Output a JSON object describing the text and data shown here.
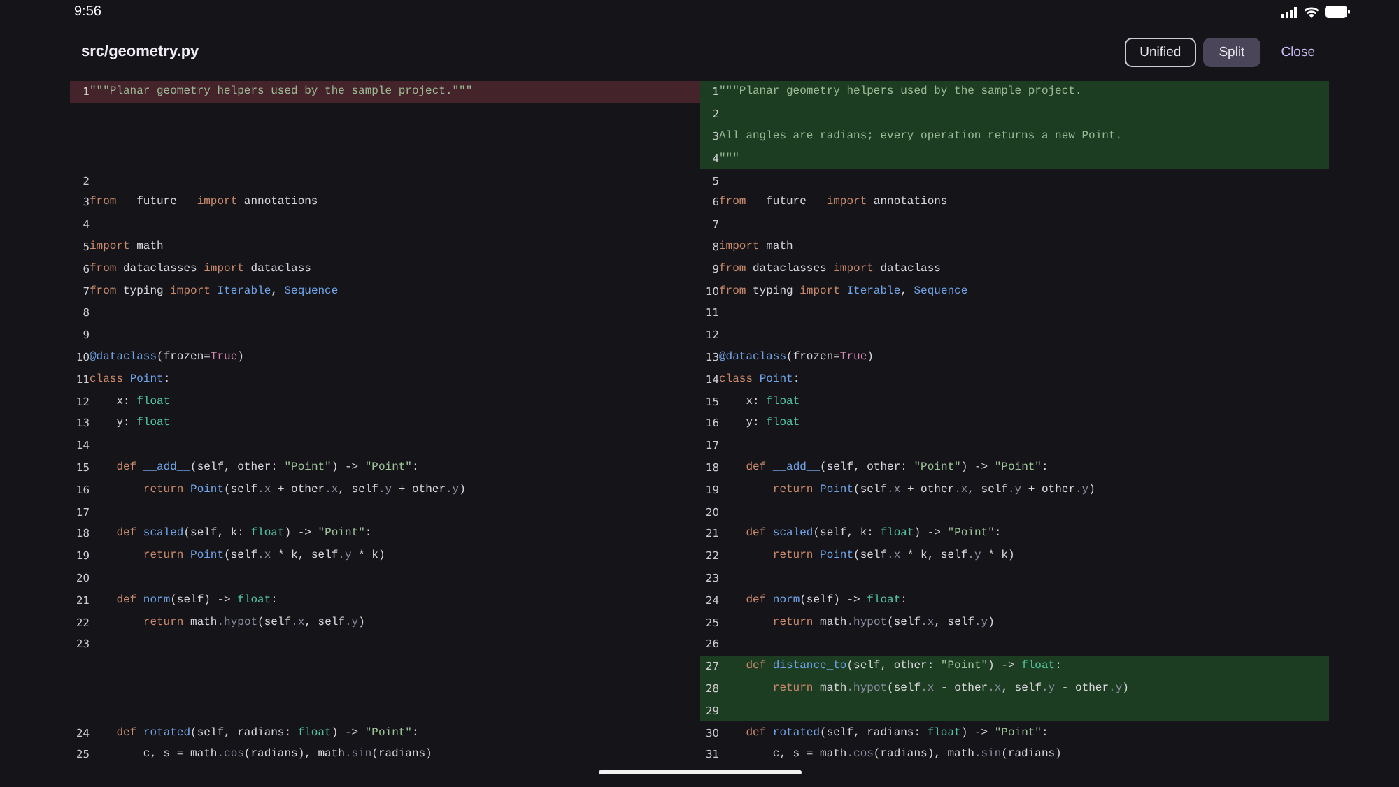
{
  "status_bar": {
    "time": "9:56"
  },
  "header": {
    "title": "src/geometry.py",
    "modes": [
      {
        "label": "Unified",
        "selected": false
      },
      {
        "label": "Split",
        "selected": true
      }
    ],
    "close": "Close"
  },
  "panes": [
    {
      "kind": "old",
      "rows": [
        {
          "num": "1",
          "changed": true,
          "tokens": [
            {
              "kind": "doc",
              "text": "\"\"\"Planar geometry helpers used by the sample project.\"\"\""
            }
          ]
        },
        {
          "changed": false
        },
        {
          "changed": false
        },
        {
          "changed": false
        },
        {
          "num": "2",
          "changed": false
        },
        {
          "num": "3",
          "changed": false,
          "tokens": [
            {
              "kind": "kw",
              "text": "from"
            },
            {
              "kind": "plain",
              "text": " __future__ "
            },
            {
              "kind": "kw",
              "text": "import"
            },
            {
              "kind": "plain",
              "text": " annotations"
            }
          ]
        },
        {
          "num": "4",
          "changed": false
        },
        {
          "num": "5",
          "changed": false,
          "tokens": [
            {
              "kind": "kw",
              "text": "import"
            },
            {
              "kind": "plain",
              "text": " math"
            }
          ]
        },
        {
          "num": "6",
          "changed": false,
          "tokens": [
            {
              "kind": "kw",
              "text": "from"
            },
            {
              "kind": "plain",
              "text": " dataclasses "
            },
            {
              "kind": "kw",
              "text": "import"
            },
            {
              "kind": "plain",
              "text": " dataclass"
            }
          ]
        },
        {
          "num": "7",
          "changed": false,
          "tokens": [
            {
              "kind": "kw",
              "text": "from"
            },
            {
              "kind": "plain",
              "text": " typing "
            },
            {
              "kind": "kw",
              "text": "import"
            },
            {
              "kind": "fn",
              "text": " Iterable"
            },
            {
              "kind": "plain",
              "text": ", "
            },
            {
              "kind": "fn",
              "text": "Sequence"
            }
          ]
        },
        {
          "num": "8",
          "changed": false
        },
        {
          "num": "9",
          "changed": false
        },
        {
          "num": "10",
          "changed": false,
          "tokens": [
            {
              "kind": "fn",
              "text": "@dataclass"
            },
            {
              "kind": "plain",
              "text": "(frozen="
            },
            {
              "kind": "const",
              "text": "True"
            },
            {
              "kind": "plain",
              "text": ")"
            }
          ]
        },
        {
          "num": "11",
          "changed": false,
          "tokens": [
            {
              "kind": "kw",
              "text": "class"
            },
            {
              "kind": "fn",
              "text": " Point"
            },
            {
              "kind": "plain",
              "text": ":"
            }
          ]
        },
        {
          "num": "12",
          "changed": false,
          "tokens": [
            {
              "kind": "plain",
              "text": "    x: "
            },
            {
              "kind": "ty",
              "text": "float"
            }
          ]
        },
        {
          "num": "13",
          "changed": false,
          "tokens": [
            {
              "kind": "plain",
              "text": "    y: "
            },
            {
              "kind": "ty",
              "text": "float"
            }
          ]
        },
        {
          "num": "14",
          "changed": false
        },
        {
          "num": "15",
          "changed": false,
          "tokens": [
            {
              "kind": "kw",
              "text": "    def"
            },
            {
              "kind": "fn",
              "text": " __add__"
            },
            {
              "kind": "plain",
              "text": "(self, other: "
            },
            {
              "kind": "str",
              "text": "\"Point\""
            },
            {
              "kind": "plain",
              "text": ") -> "
            },
            {
              "kind": "str",
              "text": "\"Point\""
            },
            {
              "kind": "plain",
              "text": ":"
            }
          ]
        },
        {
          "num": "16",
          "changed": false,
          "tokens": [
            {
              "kind": "kw",
              "text": "        return"
            },
            {
              "kind": "fn",
              "text": " Point"
            },
            {
              "kind": "plain",
              "text": "(self"
            },
            {
              "kind": "attr",
              "text": ".x"
            },
            {
              "kind": "plain",
              "text": " + other"
            },
            {
              "kind": "attr",
              "text": ".x"
            },
            {
              "kind": "plain",
              "text": ", self"
            },
            {
              "kind": "attr",
              "text": ".y"
            },
            {
              "kind": "plain",
              "text": " + other"
            },
            {
              "kind": "attr",
              "text": ".y"
            },
            {
              "kind": "plain",
              "text": ")"
            }
          ]
        },
        {
          "num": "17",
          "changed": false
        },
        {
          "num": "18",
          "changed": false,
          "tokens": [
            {
              "kind": "kw",
              "text": "    def"
            },
            {
              "kind": "fn",
              "text": " scaled"
            },
            {
              "kind": "plain",
              "text": "(self, k: "
            },
            {
              "kind": "ty",
              "text": "float"
            },
            {
              "kind": "plain",
              "text": ") -> "
            },
            {
              "kind": "str",
              "text": "\"Point\""
            },
            {
              "kind": "plain",
              "text": ":"
            }
          ]
        },
        {
          "num": "19",
          "changed": false,
          "tokens": [
            {
              "kind": "kw",
              "text": "        return"
            },
            {
              "kind": "fn",
              "text": " Point"
            },
            {
              "kind": "plain",
              "text": "(self"
            },
            {
              "kind": "attr",
              "text": ".x"
            },
            {
              "kind": "plain",
              "text": " * k, self"
            },
            {
              "kind": "attr",
              "text": ".y"
            },
            {
              "kind": "plain",
              "text": " * k)"
            }
          ]
        },
        {
          "num": "20",
          "changed": false
        },
        {
          "num": "21",
          "changed": false,
          "tokens": [
            {
              "kind": "kw",
              "text": "    def"
            },
            {
              "kind": "fn",
              "text": " norm"
            },
            {
              "kind": "plain",
              "text": "(self) -> "
            },
            {
              "kind": "ty",
              "text": "float"
            },
            {
              "kind": "plain",
              "text": ":"
            }
          ]
        },
        {
          "num": "22",
          "changed": false,
          "tokens": [
            {
              "kind": "kw",
              "text": "        return"
            },
            {
              "kind": "plain",
              "text": " math"
            },
            {
              "kind": "attr",
              "text": ".hypot"
            },
            {
              "kind": "plain",
              "text": "(self"
            },
            {
              "kind": "attr",
              "text": ".x"
            },
            {
              "kind": "plain",
              "text": ", self"
            },
            {
              "kind": "attr",
              "text": ".y"
            },
            {
              "kind": "plain",
              "text": ")"
            }
          ]
        },
        {
          "num": "23",
          "changed": false
        },
        {
          "changed": false
        },
        {
          "changed": false
        },
        {
          "changed": false
        },
        {
          "num": "24",
          "changed": false,
          "tokens": [
            {
              "kind": "kw",
              "text": "    def"
            },
            {
              "kind": "fn",
              "text": " rotated"
            },
            {
              "kind": "plain",
              "text": "(self, radians: "
            },
            {
              "kind": "ty",
              "text": "float"
            },
            {
              "kind": "plain",
              "text": ") -> "
            },
            {
              "kind": "str",
              "text": "\"Point\""
            },
            {
              "kind": "plain",
              "text": ":"
            }
          ]
        },
        {
          "num": "25",
          "changed": false,
          "tokens": [
            {
              "kind": "plain",
              "text": "        c, s = math"
            },
            {
              "kind": "attr",
              "text": ".cos"
            },
            {
              "kind": "plain",
              "text": "(radians), math"
            },
            {
              "kind": "attr",
              "text": ".sin"
            },
            {
              "kind": "plain",
              "text": "(radians)"
            }
          ]
        }
      ]
    },
    {
      "kind": "new",
      "rows": [
        {
          "num": "1",
          "changed": true,
          "tokens": [
            {
              "kind": "doc",
              "text": "\"\"\"Planar geometry helpers used by the sample project."
            }
          ]
        },
        {
          "num": "2",
          "changed": true
        },
        {
          "num": "3",
          "changed": true,
          "tokens": [
            {
              "kind": "doc",
              "text": "All angles are radians; every operation returns a new Point."
            }
          ]
        },
        {
          "num": "4",
          "changed": true,
          "tokens": [
            {
              "kind": "doc",
              "text": "\"\"\""
            }
          ]
        },
        {
          "num": "5",
          "changed": false
        },
        {
          "num": "6",
          "changed": false,
          "tokens": [
            {
              "kind": "kw",
              "text": "from"
            },
            {
              "kind": "plain",
              "text": " __future__ "
            },
            {
              "kind": "kw",
              "text": "import"
            },
            {
              "kind": "plain",
              "text": " annotations"
            }
          ]
        },
        {
          "num": "7",
          "changed": false
        },
        {
          "num": "8",
          "changed": false,
          "tokens": [
            {
              "kind": "kw",
              "text": "import"
            },
            {
              "kind": "plain",
              "text": " math"
            }
          ]
        },
        {
          "num": "9",
          "changed": false,
          "tokens": [
            {
              "kind": "kw",
              "text": "from"
            },
            {
              "kind": "plain",
              "text": " dataclasses "
            },
            {
              "kind": "kw",
              "text": "import"
            },
            {
              "kind": "plain",
              "text": " dataclass"
            }
          ]
        },
        {
          "num": "10",
          "changed": false,
          "tokens": [
            {
              "kind": "kw",
              "text": "from"
            },
            {
              "kind": "plain",
              "text": " typing "
            },
            {
              "kind": "kw",
              "text": "import"
            },
            {
              "kind": "fn",
              "text": " Iterable"
            },
            {
              "kind": "plain",
              "text": ", "
            },
            {
              "kind": "fn",
              "text": "Sequence"
            }
          ]
        },
        {
          "num": "11",
          "changed": false
        },
        {
          "num": "12",
          "changed": false
        },
        {
          "num": "13",
          "changed": false,
          "tokens": [
            {
              "kind": "fn",
              "text": "@dataclass"
            },
            {
              "kind": "plain",
              "text": "(frozen="
            },
            {
              "kind": "const",
              "text": "True"
            },
            {
              "kind": "plain",
              "text": ")"
            }
          ]
        },
        {
          "num": "14",
          "changed": false,
          "tokens": [
            {
              "kind": "kw",
              "text": "class"
            },
            {
              "kind": "fn",
              "text": " Point"
            },
            {
              "kind": "plain",
              "text": ":"
            }
          ]
        },
        {
          "num": "15",
          "changed": false,
          "tokens": [
            {
              "kind": "plain",
              "text": "    x: "
            },
            {
              "kind": "ty",
              "text": "float"
            }
          ]
        },
        {
          "num": "16",
          "changed": false,
          "tokens": [
            {
              "kind": "plain",
              "text": "    y: "
            },
            {
              "kind": "ty",
              "text": "float"
            }
          ]
        },
        {
          "num": "17",
          "changed": false
        },
        {
          "num": "18",
          "changed": false,
          "tokens": [
            {
              "kind": "kw",
              "text": "    def"
            },
            {
              "kind": "fn",
              "text": " __add__"
            },
            {
              "kind": "plain",
              "text": "(self, other: "
            },
            {
              "kind": "str",
              "text": "\"Point\""
            },
            {
              "kind": "plain",
              "text": ") -> "
            },
            {
              "kind": "str",
              "text": "\"Point\""
            },
            {
              "kind": "plain",
              "text": ":"
            }
          ]
        },
        {
          "num": "19",
          "changed": false,
          "tokens": [
            {
              "kind": "kw",
              "text": "        return"
            },
            {
              "kind": "fn",
              "text": " Point"
            },
            {
              "kind": "plain",
              "text": "(self"
            },
            {
              "kind": "attr",
              "text": ".x"
            },
            {
              "kind": "plain",
              "text": " + other"
            },
            {
              "kind": "attr",
              "text": ".x"
            },
            {
              "kind": "plain",
              "text": ", self"
            },
            {
              "kind": "attr",
              "text": ".y"
            },
            {
              "kind": "plain",
              "text": " + other"
            },
            {
              "kind": "attr",
              "text": ".y"
            },
            {
              "kind": "plain",
              "text": ")"
            }
          ]
        },
        {
          "num": "20",
          "changed": false
        },
        {
          "num": "21",
          "changed": false,
          "tokens": [
            {
              "kind": "kw",
              "text": "    def"
            },
            {
              "kind": "fn",
              "text": " scaled"
            },
            {
              "kind": "plain",
              "text": "(self, k: "
            },
            {
              "kind": "ty",
              "text": "float"
            },
            {
              "kind": "plain",
              "text": ") -> "
            },
            {
              "kind": "str",
              "text": "\"Point\""
            },
            {
              "kind": "plain",
              "text": ":"
            }
          ]
        },
        {
          "num": "22",
          "changed": false,
          "tokens": [
            {
              "kind": "kw",
              "text": "        return"
            },
            {
              "kind": "fn",
              "text": " Point"
            },
            {
              "kind": "plain",
              "text": "(self"
            },
            {
              "kind": "attr",
              "text": ".x"
            },
            {
              "kind": "plain",
              "text": " * k, self"
            },
            {
              "kind": "attr",
              "text": ".y"
            },
            {
              "kind": "plain",
              "text": " * k)"
            }
          ]
        },
        {
          "num": "23",
          "changed": false
        },
        {
          "num": "24",
          "changed": false,
          "tokens": [
            {
              "kind": "kw",
              "text": "    def"
            },
            {
              "kind": "fn",
              "text": " norm"
            },
            {
              "kind": "plain",
              "text": "(self) -> "
            },
            {
              "kind": "ty",
              "text": "float"
            },
            {
              "kind": "plain",
              "text": ":"
            }
          ]
        },
        {
          "num": "25",
          "changed": false,
          "tokens": [
            {
              "kind": "kw",
              "text": "        return"
            },
            {
              "kind": "plain",
              "text": " math"
            },
            {
              "kind": "attr",
              "text": ".hypot"
            },
            {
              "kind": "plain",
              "text": "(self"
            },
            {
              "kind": "attr",
              "text": ".x"
            },
            {
              "kind": "plain",
              "text": ", self"
            },
            {
              "kind": "attr",
              "text": ".y"
            },
            {
              "kind": "plain",
              "text": ")"
            }
          ]
        },
        {
          "num": "26",
          "changed": false
        },
        {
          "num": "27",
          "changed": true,
          "tokens": [
            {
              "kind": "kw",
              "text": "    def"
            },
            {
              "kind": "fn",
              "text": " distance_to"
            },
            {
              "kind": "plain",
              "text": "(self, other: "
            },
            {
              "kind": "str",
              "text": "\"Point\""
            },
            {
              "kind": "plain",
              "text": ") -> "
            },
            {
              "kind": "ty",
              "text": "float"
            },
            {
              "kind": "plain",
              "text": ":"
            }
          ]
        },
        {
          "num": "28",
          "changed": true,
          "tokens": [
            {
              "kind": "kw",
              "text": "        return"
            },
            {
              "kind": "plain",
              "text": " math"
            },
            {
              "kind": "attr",
              "text": ".hypot"
            },
            {
              "kind": "plain",
              "text": "(self"
            },
            {
              "kind": "attr",
              "text": ".x"
            },
            {
              "kind": "plain",
              "text": " - other"
            },
            {
              "kind": "attr",
              "text": ".x"
            },
            {
              "kind": "plain",
              "text": ", self"
            },
            {
              "kind": "attr",
              "text": ".y"
            },
            {
              "kind": "plain",
              "text": " - other"
            },
            {
              "kind": "attr",
              "text": ".y"
            },
            {
              "kind": "plain",
              "text": ")"
            }
          ]
        },
        {
          "num": "29",
          "changed": true
        },
        {
          "num": "30",
          "changed": false,
          "tokens": [
            {
              "kind": "kw",
              "text": "    def"
            },
            {
              "kind": "fn",
              "text": " rotated"
            },
            {
              "kind": "plain",
              "text": "(self, radians: "
            },
            {
              "kind": "ty",
              "text": "float"
            },
            {
              "kind": "plain",
              "text": ") -> "
            },
            {
              "kind": "str",
              "text": "\"Point\""
            },
            {
              "kind": "plain",
              "text": ":"
            }
          ]
        },
        {
          "num": "31",
          "changed": false,
          "tokens": [
            {
              "kind": "plain",
              "text": "        c, s = math"
            },
            {
              "kind": "attr",
              "text": ".cos"
            },
            {
              "kind": "plain",
              "text": "(radians), math"
            },
            {
              "kind": "attr",
              "text": ".sin"
            },
            {
              "kind": "plain",
              "text": "(radians)"
            }
          ]
        }
      ]
    }
  ]
}
